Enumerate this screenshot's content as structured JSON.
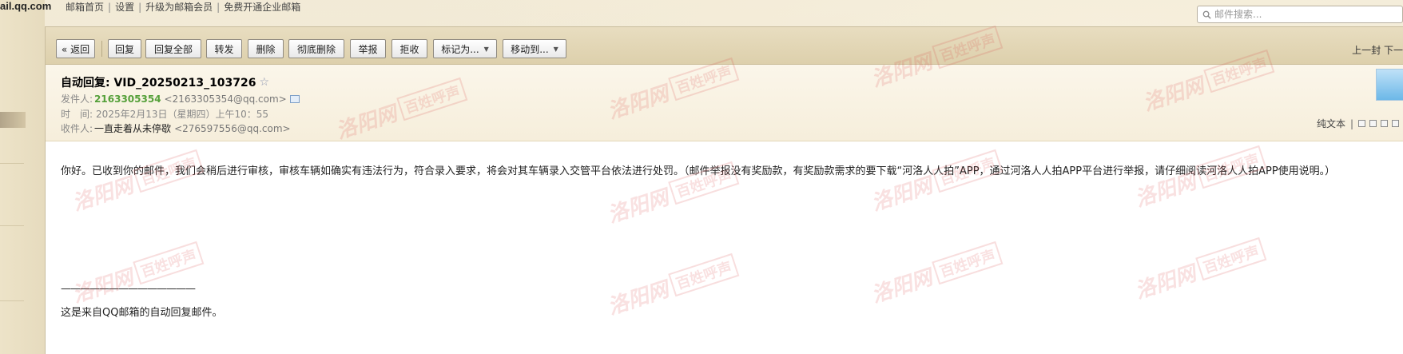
{
  "top": {
    "account": "ail.qq.com",
    "links": [
      "邮箱首页",
      "设置",
      "升级为邮箱会员",
      "免费开通企业邮箱"
    ]
  },
  "search": {
    "placeholder": "邮件搜索..."
  },
  "toolbar": {
    "back": "« 返回",
    "reply": "回复",
    "reply_all": "回复全部",
    "forward": "转发",
    "delete": "删除",
    "delete_permanently": "彻底删除",
    "report": "举报",
    "reject": "拒收",
    "mark_as": "标记为...",
    "move_to": "移动到...",
    "nav": "上一封 下一"
  },
  "mail": {
    "subject": "自动回复: VID_20250213_103726",
    "star": "☆",
    "from_label": "发件人:",
    "from_name": "2163305354",
    "from_addr": "<2163305354@qq.com>",
    "time_label": "时　间:",
    "time_value": "2025年2月13日（星期四）上午10：55",
    "to_label": "收件人:",
    "to_name": "一直走着从未停歇",
    "to_addr": "<276597556@qq.com>",
    "plain_text": "纯文本",
    "body": "你好。已收到你的邮件，我们会稍后进行审核，审核车辆如确实有违法行为，符合录入要求，将会对其车辆录入交管平台依法进行处罚。（邮件举报没有奖励款，有奖励款需求的要下载“河洛人人拍”APP，通过河洛人人拍APP平台进行举报，请仔细阅读河洛人人拍APP使用说明。）",
    "divider": "——————————————",
    "footer": "这是来自QQ邮箱的自动回复邮件。"
  },
  "watermark": {
    "text": "洛阳网",
    "box": "百姓呼声"
  }
}
